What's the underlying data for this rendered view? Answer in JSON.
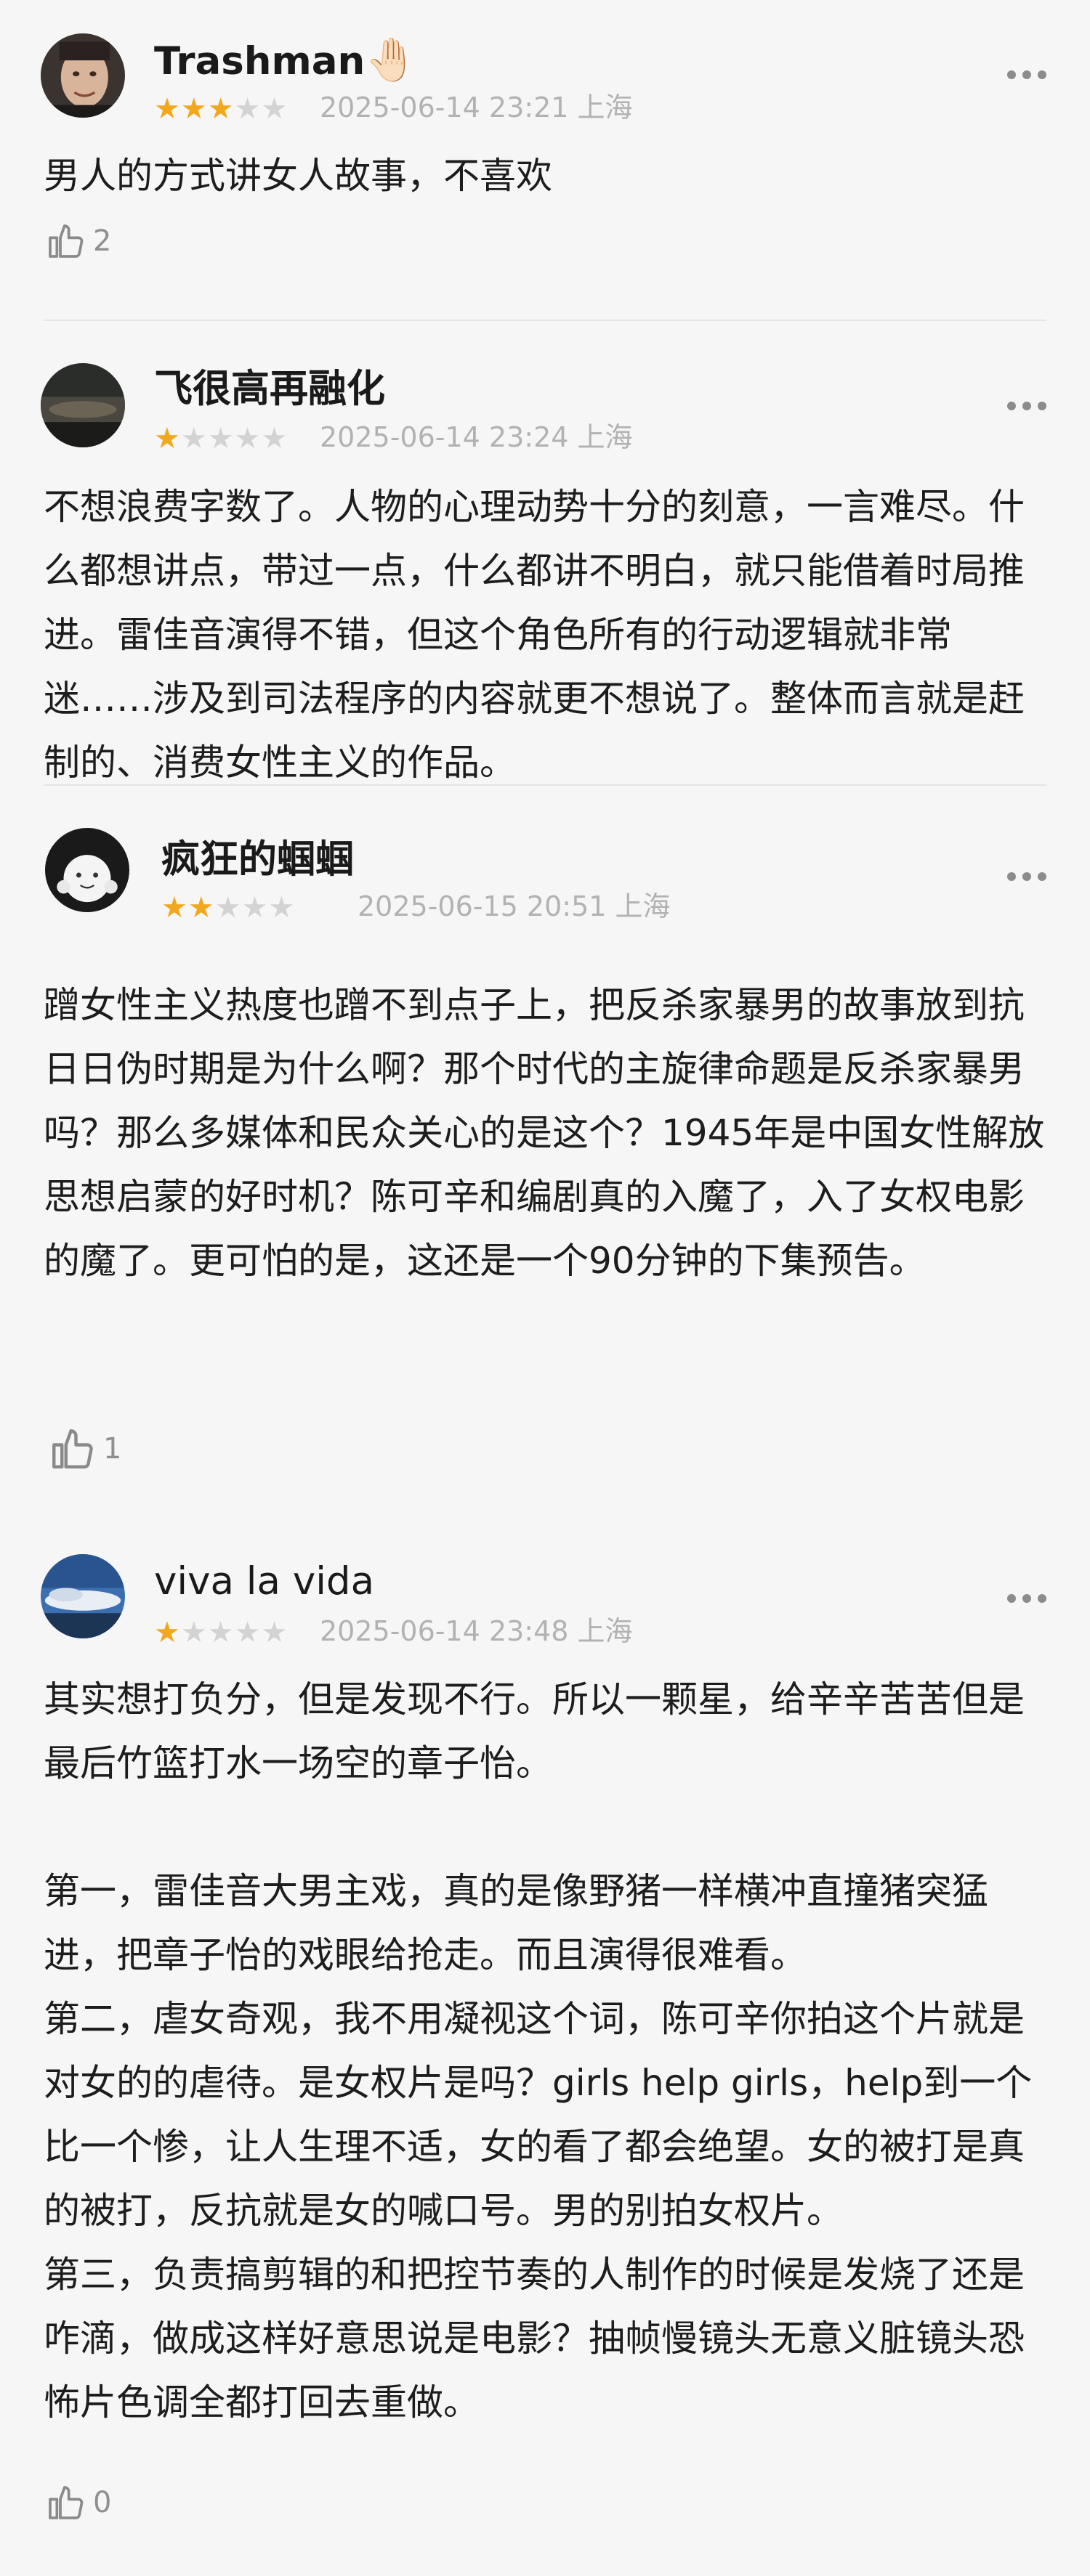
{
  "reviews": [
    {
      "username": "Trashman",
      "emoji": "🤚🏻",
      "rating": 3,
      "date": "2025-06-14 23:21",
      "location": "上海",
      "text": "男人的方式讲女人故事，不喜欢",
      "likes": "2"
    },
    {
      "username": "飞很高再融化",
      "rating": 1,
      "date": "2025-06-14 23:24",
      "location": "上海",
      "text": "不想浪费字数了。人物的心理动势十分的刻意，一言难尽。什么都想讲点，带过一点，什么都讲不明白，就只能借着时局推进。雷佳音演得不错，但这个角色所有的行动逻辑就非常迷……涉及到司法程序的内容就更不想说了。整体而言就是赶制的、消费女性主义的作品。"
    },
    {
      "username": "疯狂的蝈蝈",
      "rating": 2,
      "date": "2025-06-15 20:51",
      "location": "上海",
      "text": "蹭女性主义热度也蹭不到点子上，把反杀家暴男的故事放到抗日日伪时期是为什么啊？那个时代的主旋律命题是反杀家暴男吗？那么多媒体和民众关心的是这个？1945年是中国女性解放思想启蒙的好时机？陈可辛和编剧真的入魔了，入了女权电影的魔了。更可怕的是，这还是一个90分钟的下集预告。",
      "likes": "1"
    },
    {
      "username": "viva la vida",
      "rating": 1,
      "date": "2025-06-14 23:48",
      "location": "上海",
      "text": "其实想打负分，但是发现不行。所以一颗星，给辛辛苦苦但是最后竹篮打水一场空的章子怡。\n\n第一，雷佳音大男主戏，真的是像野猪一样横冲直撞猪突猛进，把章子怡的戏眼给抢走。而且演得很难看。\n第二，虐女奇观，我不用凝视这个词，陈可辛你拍这个片就是对女的的虐待。是女权片是吗？girls help girls，help到一个比一个惨，让人生理不适，女的看了都会绝望。女的被打是真的被打，反抗就是女的喊口号。男的别拍女权片。\n第三，负责搞剪辑的和把控节奏的人制作的时候是发烧了还是咋滴，做成这样好意思说是电影？抽帧慢镜头无意义脏镜头恐怖片色调全都打回去重做。",
      "likes": "0"
    }
  ],
  "colors": {
    "star_on": "#f2a81e",
    "star_off": "#d3d3d3",
    "meta": "#b2b2b2"
  },
  "icons": [
    "thumbs-up-icon",
    "more-dots-icon"
  ]
}
